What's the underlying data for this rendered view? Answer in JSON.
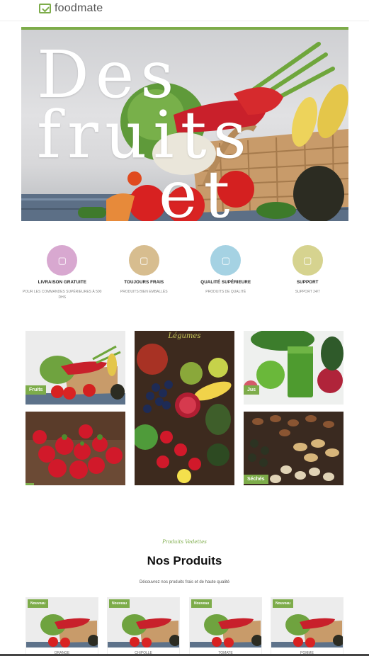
{
  "header": {
    "logo_text": "foodmate"
  },
  "hero": {
    "title_line1": "Des fruits",
    "title_line2": "et"
  },
  "features": [
    {
      "title": "LIVRAISON GRATUITE",
      "desc": "POUR LES COMMANDES SUPÉRIEURES À 500 DHS",
      "color": "#d8a8d0"
    },
    {
      "title": "TOUJOURS FRAIS",
      "desc": "PRODUITS BIEN EMBALLÉS",
      "color": "#d7bd8f"
    },
    {
      "title": "QUALITÉ SUPÉRIEURE",
      "desc": "PRODUITS DE QUALITÉ",
      "color": "#a5d2e3"
    },
    {
      "title": "SUPPORT",
      "desc": "SUPPORT 24/7",
      "color": "#d6d38f"
    }
  ],
  "categories": {
    "fruits": "Fruits",
    "legumes": "Légumes",
    "jus": "Jus",
    "seches": "Séchés"
  },
  "products": {
    "kicker": "Produits Vedettes",
    "title": "Nos Produits",
    "subtitle": "Découvrez nos produits frais et de haute qualité",
    "badge": "Nouveau",
    "items": [
      "ORANGE",
      "CHIPOLLE",
      "TOMATE",
      "POMME"
    ]
  }
}
